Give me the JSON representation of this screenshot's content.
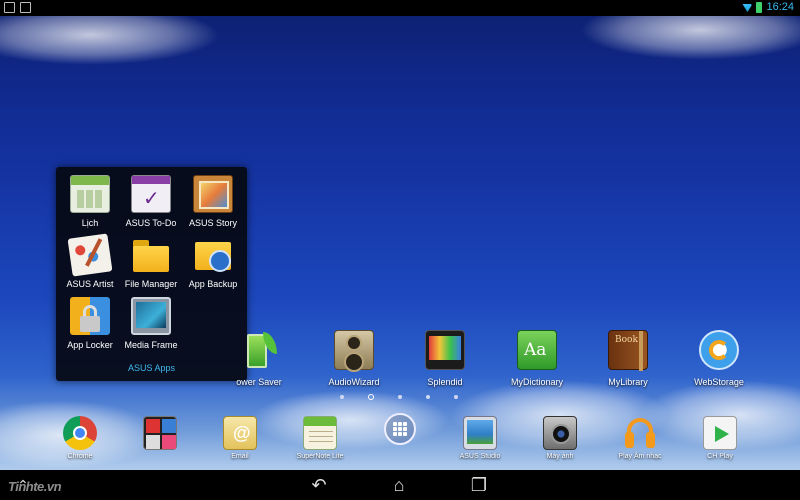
{
  "status_bar": {
    "time": "16:24"
  },
  "folder": {
    "title": "ASUS Apps",
    "apps": [
      {
        "label": "Lịch",
        "icon": "calendar-icon"
      },
      {
        "label": "ASUS To-Do",
        "icon": "todo-check-icon"
      },
      {
        "label": "ASUS Story",
        "icon": "story-album-icon"
      },
      {
        "label": "ASUS Artist",
        "icon": "artist-brush-icon"
      },
      {
        "label": "File Manager",
        "icon": "folder-icon"
      },
      {
        "label": "App Backup",
        "icon": "backup-icon"
      },
      {
        "label": "App Locker",
        "icon": "lock-icon"
      },
      {
        "label": "Media Frame",
        "icon": "media-frame-icon"
      }
    ]
  },
  "home_apps": [
    {
      "label": "ower Saver",
      "icon": "power-saver-icon"
    },
    {
      "label": "AudioWizard",
      "icon": "speaker-icon"
    },
    {
      "label": "Splendid",
      "icon": "splendid-display-icon"
    },
    {
      "label": "MyDictionary",
      "icon": "dictionary-icon"
    },
    {
      "label": "MyLibrary",
      "icon": "book-icon"
    },
    {
      "label": "WebStorage",
      "icon": "webstorage-sync-icon"
    }
  ],
  "dock": [
    {
      "label": "Chrome",
      "icon": "chrome-icon"
    },
    {
      "label": "",
      "icon": "widget-collage-icon"
    },
    {
      "label": "Email",
      "icon": "email-icon"
    },
    {
      "label": "SuperNote Lite",
      "icon": "supernote-icon"
    },
    {
      "label": "",
      "icon": "all-apps-icon"
    },
    {
      "label": "ASUS Studio",
      "icon": "studio-gallery-icon"
    },
    {
      "label": "Máy ảnh",
      "icon": "camera-icon"
    },
    {
      "label": "Play Âm nhạc",
      "icon": "headphones-icon"
    },
    {
      "label": "CH Play",
      "icon": "play-store-icon"
    }
  ],
  "watermark": "Tinhte.vn",
  "colors": {
    "accent": "#3fb9ef",
    "status_bar": "#000000"
  }
}
